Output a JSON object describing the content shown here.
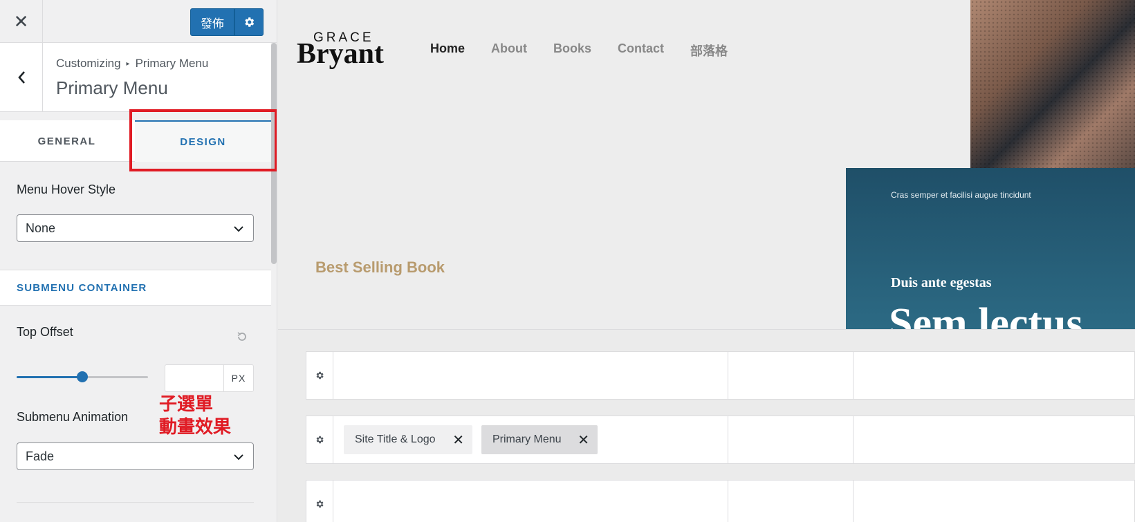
{
  "topbar": {
    "close_glyph": "✕",
    "publish_label": "發佈",
    "settings_icon": "gear-icon"
  },
  "section_header": {
    "breadcrumb_root": "Customizing",
    "breadcrumb_sep": "▸",
    "breadcrumb_current": "Primary Menu",
    "title": "Primary Menu"
  },
  "tabs": [
    {
      "label": "GENERAL",
      "active": false
    },
    {
      "label": "DESIGN",
      "active": true
    }
  ],
  "controls": {
    "hover_style": {
      "label": "Menu Hover Style",
      "value": "None"
    },
    "submenu_section": "SUBMENU CONTAINER",
    "top_offset": {
      "label": "Top Offset",
      "slider_fraction": 0.5,
      "value": "",
      "unit": "PX"
    },
    "submenu_animation": {
      "label": "Submenu Animation",
      "value": "Fade"
    }
  },
  "annotation": {
    "line1": "子選單",
    "line2": "動畫效果",
    "color": "#e01b24"
  },
  "preview": {
    "logo_top": "GRACE",
    "logo_main": "Bryant",
    "nav": [
      "Home",
      "About",
      "Books",
      "Contact",
      "部落格"
    ],
    "hero_label": "Best Selling Book",
    "book_small": "Cras semper et facilisi augue tincidunt",
    "book_subtitle": "Duis ante egestas",
    "book_title": "Sem lectus"
  },
  "builder": {
    "rows": [
      {
        "chips": []
      },
      {
        "chips": [
          {
            "label": "Site Title & Logo",
            "remove": "✕"
          },
          {
            "label": "Primary Menu",
            "remove": "✕"
          }
        ]
      },
      {
        "chips": []
      }
    ]
  },
  "colors": {
    "accent": "#2271b1",
    "highlight": "#e01b24",
    "hero_label": "#b89b6e"
  }
}
